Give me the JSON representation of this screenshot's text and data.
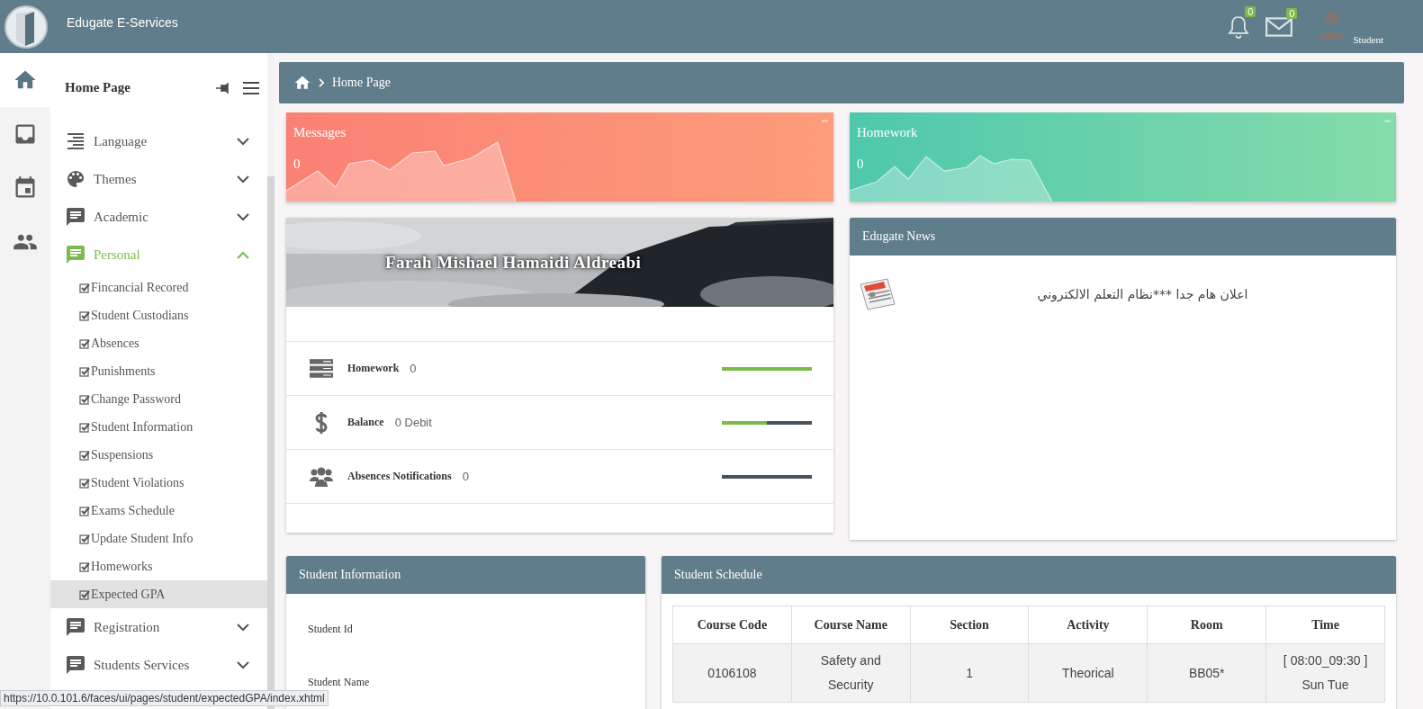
{
  "header": {
    "title": "Edugate E-Services",
    "notifications": "0",
    "messages": "0",
    "user": "Student"
  },
  "rail": [
    {
      "kind": "home",
      "selected": true
    },
    {
      "kind": "inbox",
      "selected": false
    },
    {
      "kind": "calendar",
      "selected": false
    },
    {
      "kind": "people",
      "selected": false
    }
  ],
  "menu": {
    "title": "Home Page",
    "items": [
      {
        "kind": "language",
        "label": "Language",
        "expanded": false
      },
      {
        "kind": "themes",
        "label": "Themes",
        "expanded": false
      },
      {
        "kind": "chat",
        "label": "Academic",
        "expanded": false
      },
      {
        "kind": "chat",
        "label": "Personal",
        "expanded": true,
        "children": [
          {
            "label": "Fincancial Recored",
            "selected": false
          },
          {
            "label": "Student Custodians",
            "selected": false
          },
          {
            "label": "Absences",
            "selected": false
          },
          {
            "label": "Punishments",
            "selected": false
          },
          {
            "label": "Change Password",
            "selected": false
          },
          {
            "label": "Student Information",
            "selected": false
          },
          {
            "label": "Suspensions",
            "selected": false
          },
          {
            "label": "Student Violations",
            "selected": false
          },
          {
            "label": "Exams Schedule",
            "selected": false
          },
          {
            "label": "Update Student Info",
            "selected": false
          },
          {
            "label": "Homeworks",
            "selected": false
          },
          {
            "label": "Expected GPA",
            "selected": true
          }
        ]
      },
      {
        "kind": "chat",
        "label": "Registration",
        "expanded": false
      },
      {
        "kind": "chat",
        "label": "Students Services",
        "expanded": false
      }
    ]
  },
  "breadcrumb": {
    "label": "Home Page"
  },
  "stat_cards": [
    {
      "kind": "messages",
      "title": "Messages",
      "value": "0"
    },
    {
      "kind": "homework",
      "title": "Homework",
      "value": "0"
    }
  ],
  "profile": {
    "name": "Farah Mishael Hamaidi Aldreabi",
    "rows": [
      {
        "kind": "homework",
        "label": "Homework",
        "value": "0",
        "level": 1
      },
      {
        "kind": "balance",
        "label": "Balance",
        "value": "0 Debit",
        "level": 0.5
      },
      {
        "kind": "absences",
        "label": "Absences Notifications",
        "value": "0",
        "level": 0
      }
    ]
  },
  "news": {
    "title": "Edugate News",
    "items": [
      "اعلان هام جدا ***نظام التعلم الالكتروني"
    ]
  },
  "student_info": {
    "title": "Student Information",
    "fields": [
      "Student Id",
      "Student Name"
    ]
  },
  "schedule": {
    "title": "Student Schedule",
    "columns": [
      "Course Code",
      "Course Name",
      "Section",
      "Activity",
      "Room",
      "Time"
    ],
    "rows": [
      [
        "0106108",
        "Safety and Security",
        "1",
        "Theorical",
        "BB05*",
        "[ 08:00_09:30 ] Sun Tue"
      ]
    ]
  },
  "status_bar": "https://10.0.101.6/faces/ui/pages/student/expectedGPA/index.xhtml"
}
